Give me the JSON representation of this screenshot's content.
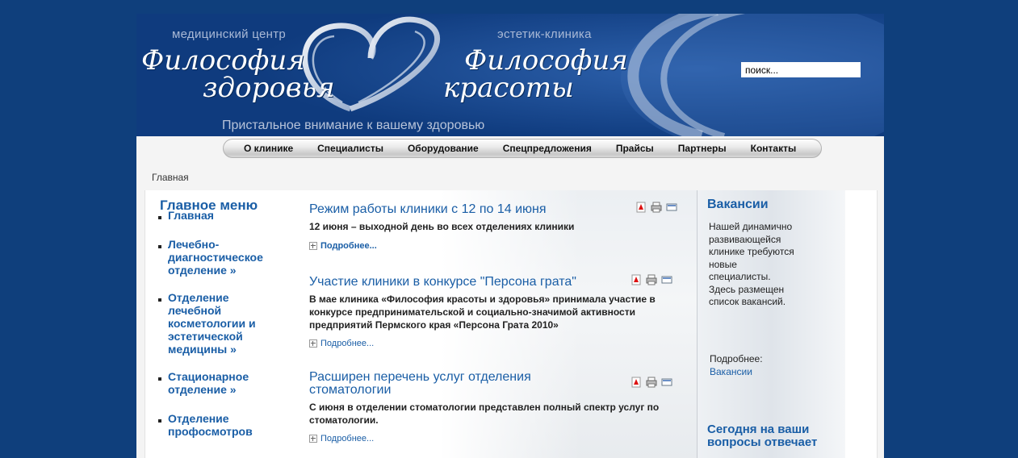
{
  "header": {
    "left_subtitle": "медицинский центр",
    "left_brand_line1": "Философия",
    "left_brand_line2": "здоровья",
    "right_subtitle": "эстетик-клиника",
    "right_brand_line1": "Философия",
    "right_brand_line2": "красоты",
    "slogan": "Пристальное внимание к вашему здоровью",
    "search_value": "поиск..."
  },
  "nav": {
    "items": [
      {
        "label": "О клинике"
      },
      {
        "label": "Специалисты"
      },
      {
        "label": "Оборудование"
      },
      {
        "label": "Спецпредложения"
      },
      {
        "label": "Прайсы"
      },
      {
        "label": "Партнеры"
      },
      {
        "label": "Контакты"
      }
    ]
  },
  "breadcrumb": "Главная",
  "left_menu": {
    "title": "Главное меню",
    "items": [
      {
        "label": "Главная"
      },
      {
        "label": "Лечебно-диагностическое отделение »"
      },
      {
        "label": "Отделение лечебной косметологии и эстетической медицины »"
      },
      {
        "label": "Стационарное отделение »"
      },
      {
        "label": "Отделение профосмотров"
      }
    ]
  },
  "articles": [
    {
      "title": "Режим работы клиники с 12 по 14 июня",
      "body": "12 июня – выходной день во всех отделениях клиники",
      "more": "Подробнее..."
    },
    {
      "title": "Участие клиники в конкурсе \"Персона грата\"",
      "body": "В мае клиника «Философия красоты и здоровья» принимала участие в конкурсе предпринимательской и социально-значимой активности предприятий Пермского края «Персона Грата 2010»",
      "more": "Подробнее..."
    },
    {
      "title": "Расширен перечень услуг отделения стоматологии",
      "body": "С июня в отделении стоматологии представлен полный спектр услуг по стоматологии.",
      "more": "Подробнее..."
    }
  ],
  "right_panel": {
    "title": "Вакансии",
    "text": "Нашей динамично развивающейся клинике требуются новые специалисты. Здесь размещен список вакансий.",
    "more_label": "Подробнее:",
    "more_link": "Вакансии",
    "title2": "Сегодня на ваши вопросы отвечает"
  },
  "icons": [
    "pdf-icon",
    "print-icon",
    "email-icon"
  ],
  "colors": {
    "background": "#0f3f7c",
    "header": "#113f86",
    "link": "#1a5ea6"
  }
}
